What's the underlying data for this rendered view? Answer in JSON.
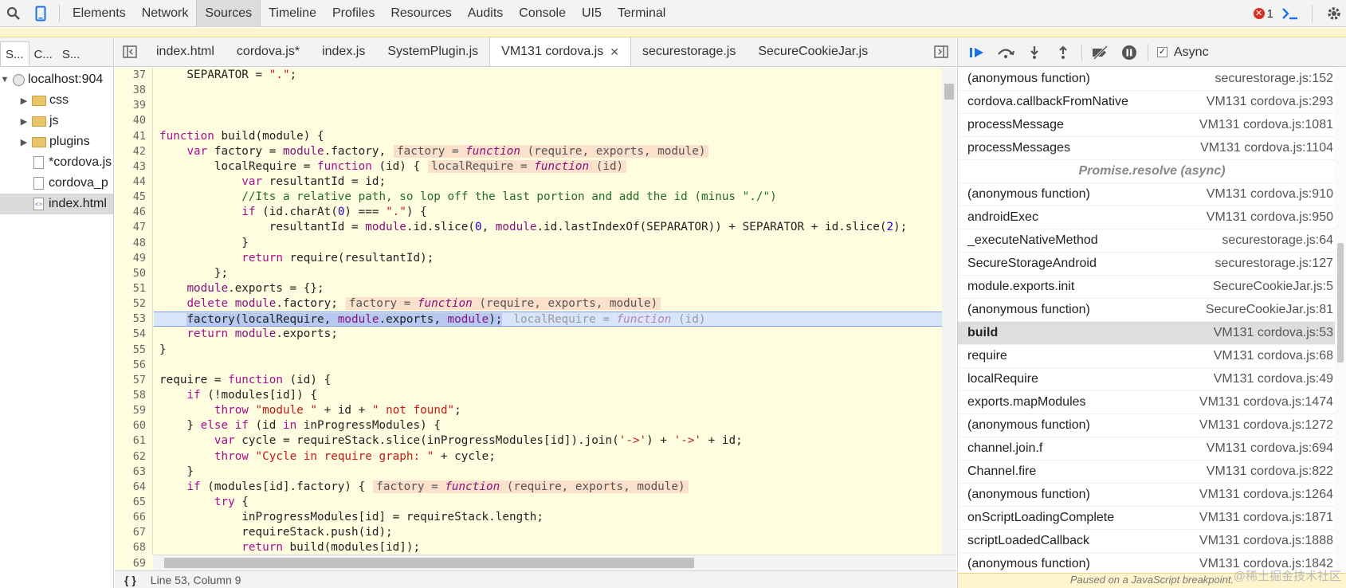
{
  "toolbar": {
    "tabs": [
      "Elements",
      "Network",
      "Sources",
      "Timeline",
      "Profiles",
      "Resources",
      "Audits",
      "Console",
      "UI5",
      "Terminal"
    ],
    "active_tab": "Sources",
    "error_count": "1"
  },
  "navigator": {
    "tabs": [
      "S...",
      "C...",
      "S..."
    ],
    "root": "localhost:904",
    "items": [
      {
        "label": "css",
        "kind": "folder"
      },
      {
        "label": "js",
        "kind": "folder"
      },
      {
        "label": "plugins",
        "kind": "folder"
      },
      {
        "label": "*cordova.js",
        "kind": "file"
      },
      {
        "label": "cordova_p",
        "kind": "file"
      },
      {
        "label": "index.html",
        "kind": "file",
        "selected": true
      }
    ]
  },
  "editor": {
    "tabs": [
      "index.html",
      "cordova.js*",
      "index.js",
      "SystemPlugin.js",
      "VM131 cordova.js",
      "securestorage.js",
      "SecureCookieJar.js"
    ],
    "active_tab": "VM131 cordova.js",
    "first_line": 37,
    "execution_line": 53,
    "status": "Line 53, Column 9"
  },
  "debugger": {
    "async_label": "Async",
    "async_checked": true,
    "call_stack": [
      {
        "fn": "(anonymous function)",
        "loc": "securestorage.js:152"
      },
      {
        "fn": "cordova.callbackFromNative",
        "loc": "VM131 cordova.js:293"
      },
      {
        "fn": "processMessage",
        "loc": "VM131 cordova.js:1081"
      },
      {
        "fn": "processMessages",
        "loc": "VM131 cordova.js:1104"
      },
      {
        "separator": "Promise.resolve (async)"
      },
      {
        "fn": "(anonymous function)",
        "loc": "VM131 cordova.js:910"
      },
      {
        "fn": "androidExec",
        "loc": "VM131 cordova.js:950"
      },
      {
        "fn": "_executeNativeMethod",
        "loc": "securestorage.js:64"
      },
      {
        "fn": "SecureStorageAndroid",
        "loc": "securestorage.js:127"
      },
      {
        "fn": "module.exports.init",
        "loc": "SecureCookieJar.js:5"
      },
      {
        "fn": "(anonymous function)",
        "loc": "SecureCookieJar.js:81"
      },
      {
        "fn": "build",
        "loc": "VM131 cordova.js:53",
        "selected": true
      },
      {
        "fn": "require",
        "loc": "VM131 cordova.js:68"
      },
      {
        "fn": "localRequire",
        "loc": "VM131 cordova.js:49"
      },
      {
        "fn": "exports.mapModules",
        "loc": "VM131 cordova.js:1474"
      },
      {
        "fn": "(anonymous function)",
        "loc": "VM131 cordova.js:1272"
      },
      {
        "fn": "channel.join.f",
        "loc": "VM131 cordova.js:694"
      },
      {
        "fn": "Channel.fire",
        "loc": "VM131 cordova.js:822"
      },
      {
        "fn": "(anonymous function)",
        "loc": "VM131 cordova.js:1264"
      },
      {
        "fn": "onScriptLoadingComplete",
        "loc": "VM131 cordova.js:1871"
      },
      {
        "fn": "scriptLoadedCallback",
        "loc": "VM131 cordova.js:1888"
      },
      {
        "fn": "(anonymous function)",
        "loc": "VM131 cordova.js:1842"
      }
    ],
    "paused_message": "Paused on a JavaScript breakpoint."
  },
  "watermark": "@稀土掘金技术社区",
  "colors": {
    "accent": "#1a73e8",
    "error": "#d93025",
    "paused_bg": "#fff5cc",
    "editor_bg": "#fffde0",
    "exec_line": "#d9e5fb"
  }
}
